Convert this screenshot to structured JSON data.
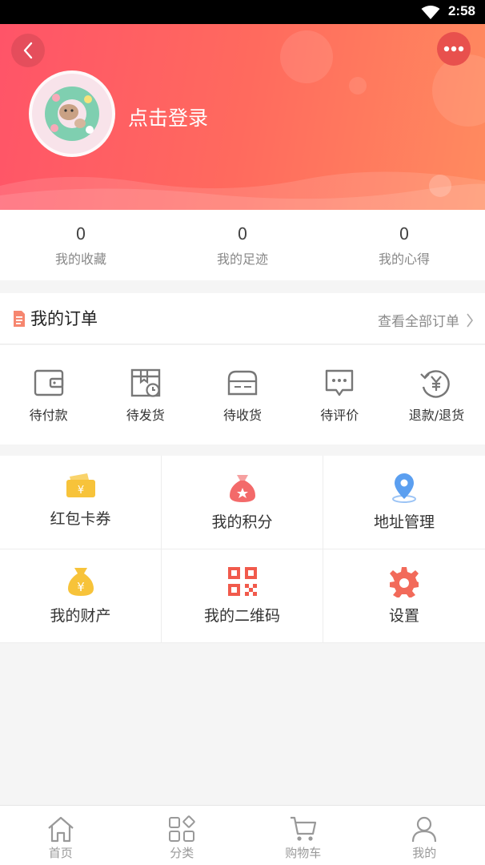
{
  "status_bar": {
    "time": "2:58"
  },
  "profile": {
    "login_text": "点击登录"
  },
  "stats": [
    {
      "value": "0",
      "label": "我的收藏"
    },
    {
      "value": "0",
      "label": "我的足迹"
    },
    {
      "value": "0",
      "label": "我的心得"
    }
  ],
  "orders": {
    "title": "我的订单",
    "view_all": "查看全部订单",
    "items": [
      {
        "label": "待付款",
        "icon": "wallet-icon"
      },
      {
        "label": "待发货",
        "icon": "package-clock-icon"
      },
      {
        "label": "待收货",
        "icon": "delivery-card-icon"
      },
      {
        "label": "待评价",
        "icon": "comment-icon"
      },
      {
        "label": "退款/退货",
        "icon": "refund-icon"
      }
    ]
  },
  "services": [
    {
      "label": "红包卡券",
      "icon": "coupon-icon"
    },
    {
      "label": "我的积分",
      "icon": "points-bag-icon"
    },
    {
      "label": "地址管理",
      "icon": "location-pin-icon"
    },
    {
      "label": "我的财产",
      "icon": "money-bag-icon"
    },
    {
      "label": "我的二维码",
      "icon": "qr-code-icon"
    },
    {
      "label": "设置",
      "icon": "gear-icon"
    }
  ],
  "bottom_nav": [
    {
      "label": "首页",
      "icon": "home-icon"
    },
    {
      "label": "分类",
      "icon": "category-icon"
    },
    {
      "label": "购物车",
      "icon": "cart-icon"
    },
    {
      "label": "我的",
      "icon": "user-icon"
    }
  ],
  "colors": {
    "header_start": "#ff5468",
    "header_end": "#ff8b5f",
    "coupon": "#f7c33a",
    "points": "#f36a6a",
    "location": "#5b9ff0",
    "qr": "#f15a4c",
    "settings": "#f26a5a"
  }
}
